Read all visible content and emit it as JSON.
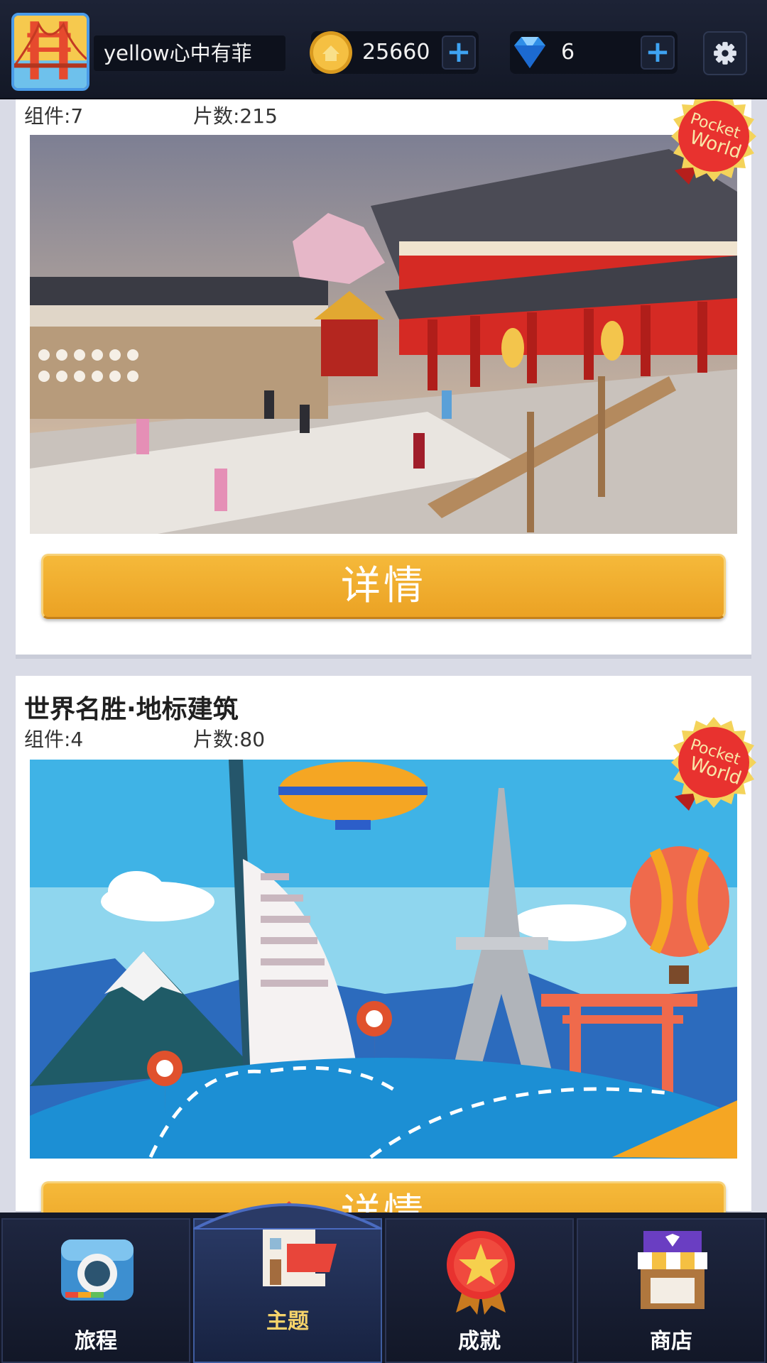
{
  "header": {
    "username": "yellow心中有菲",
    "coins": "25660",
    "gems": "6",
    "plus_label": "+"
  },
  "cards": [
    {
      "title": "",
      "components_label": "组件:7",
      "pieces_label": "片数:215",
      "button_label": "详情",
      "badge_text": [
        "Pocket",
        "World"
      ]
    },
    {
      "title": "世界名胜·地标建筑",
      "components_label": "组件:4",
      "pieces_label": "片数:80",
      "button_label": "详情",
      "badge_text": [
        "Pocket",
        "World"
      ]
    }
  ],
  "nav": {
    "items": [
      {
        "label": "旅程",
        "icon": "camera-icon"
      },
      {
        "label": "主题",
        "icon": "house-icon",
        "active": true
      },
      {
        "label": "成就",
        "icon": "star-medal-icon"
      },
      {
        "label": "商店",
        "icon": "shop-icon"
      }
    ]
  },
  "colors": {
    "accent_button": "#F0AA2C",
    "topbar": "#161B2A",
    "active_label": "#F6D36A",
    "badge_red": "#E8322F"
  }
}
